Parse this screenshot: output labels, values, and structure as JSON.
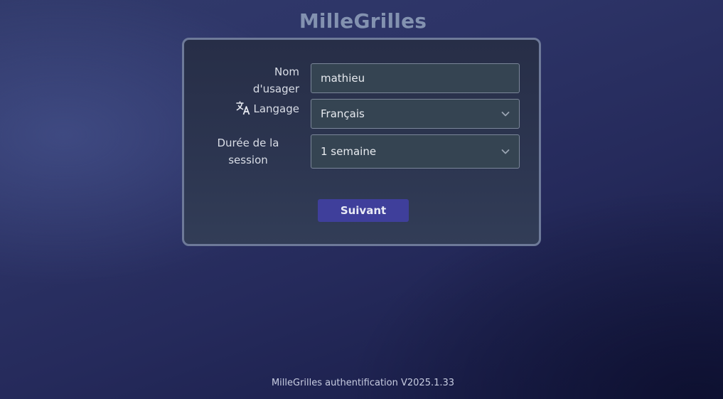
{
  "app": {
    "title": "MilleGrilles"
  },
  "form": {
    "username": {
      "label": "Nom d'usager",
      "value": "mathieu"
    },
    "language": {
      "label": "Langage",
      "icon": "translate-icon",
      "selected": "Français"
    },
    "session_duration": {
      "label": "Durée de la session",
      "selected": "1 semaine"
    },
    "next_label": "Suivant"
  },
  "footer": {
    "text": "MilleGrilles authentification V2025.1.33"
  },
  "colors": {
    "accent_button": "#3f3f9b",
    "title": "#8392b0",
    "card_border": "#6e7a99"
  }
}
